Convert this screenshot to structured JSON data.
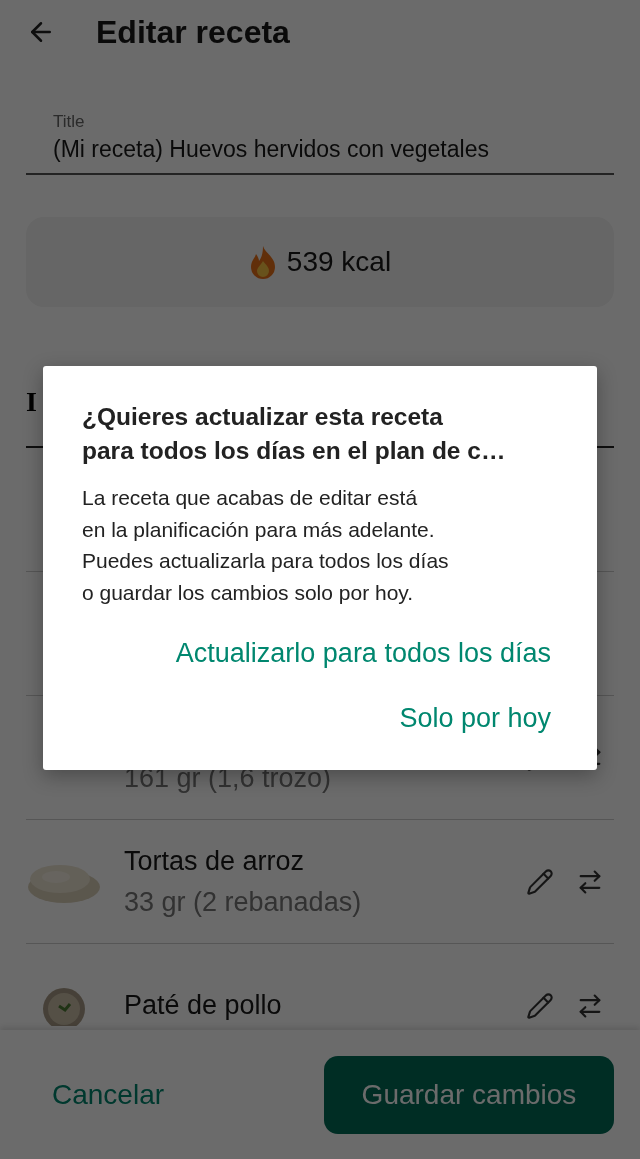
{
  "header": {
    "title": "Editar receta"
  },
  "title_field": {
    "label": "Title",
    "value": "(Mi receta) Huevos hervidos con vegetales"
  },
  "calories": "539 kcal",
  "section_heading": "I",
  "ingredients": [
    {
      "amount": "161 gr (1,6 trozo)"
    },
    {
      "name": "Tortas de arroz",
      "amount": "33 gr (2 rebanadas)",
      "picture": true
    },
    {
      "name": "Paté de pollo",
      "picture": true
    }
  ],
  "footer": {
    "cancel": "Cancelar",
    "save": "Guardar cambios"
  },
  "dialog": {
    "title": "¿Quieres actualizar esta receta\npara todos los días en el plan de c…",
    "body": "La receta que acabas de editar está\nen la planificación para más adelante.\nPuedes actualizarla para todos los días\no guardar los cambios solo por hoy.",
    "actions": [
      "Actualizarlo para todos los días",
      "Solo por hoy"
    ]
  }
}
